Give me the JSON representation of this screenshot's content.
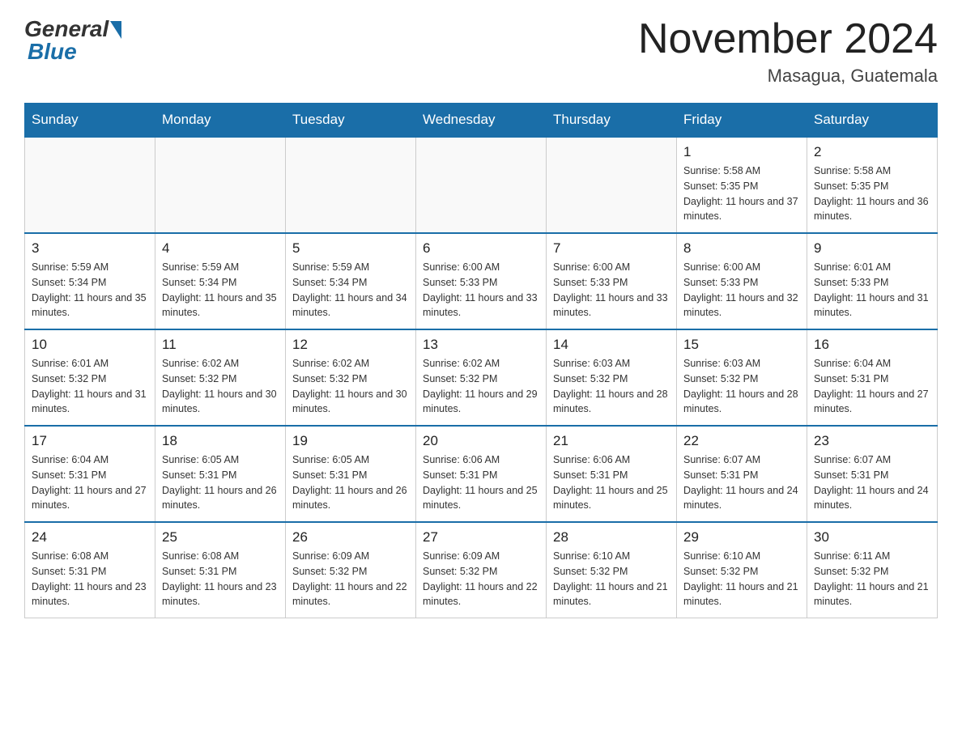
{
  "header": {
    "logo_general": "General",
    "logo_blue": "Blue",
    "month_title": "November 2024",
    "location": "Masagua, Guatemala"
  },
  "days_of_week": [
    "Sunday",
    "Monday",
    "Tuesday",
    "Wednesday",
    "Thursday",
    "Friday",
    "Saturday"
  ],
  "weeks": [
    [
      {
        "day": "",
        "sunrise": "",
        "sunset": "",
        "daylight": ""
      },
      {
        "day": "",
        "sunrise": "",
        "sunset": "",
        "daylight": ""
      },
      {
        "day": "",
        "sunrise": "",
        "sunset": "",
        "daylight": ""
      },
      {
        "day": "",
        "sunrise": "",
        "sunset": "",
        "daylight": ""
      },
      {
        "day": "",
        "sunrise": "",
        "sunset": "",
        "daylight": ""
      },
      {
        "day": "1",
        "sunrise": "Sunrise: 5:58 AM",
        "sunset": "Sunset: 5:35 PM",
        "daylight": "Daylight: 11 hours and 37 minutes."
      },
      {
        "day": "2",
        "sunrise": "Sunrise: 5:58 AM",
        "sunset": "Sunset: 5:35 PM",
        "daylight": "Daylight: 11 hours and 36 minutes."
      }
    ],
    [
      {
        "day": "3",
        "sunrise": "Sunrise: 5:59 AM",
        "sunset": "Sunset: 5:34 PM",
        "daylight": "Daylight: 11 hours and 35 minutes."
      },
      {
        "day": "4",
        "sunrise": "Sunrise: 5:59 AM",
        "sunset": "Sunset: 5:34 PM",
        "daylight": "Daylight: 11 hours and 35 minutes."
      },
      {
        "day": "5",
        "sunrise": "Sunrise: 5:59 AM",
        "sunset": "Sunset: 5:34 PM",
        "daylight": "Daylight: 11 hours and 34 minutes."
      },
      {
        "day": "6",
        "sunrise": "Sunrise: 6:00 AM",
        "sunset": "Sunset: 5:33 PM",
        "daylight": "Daylight: 11 hours and 33 minutes."
      },
      {
        "day": "7",
        "sunrise": "Sunrise: 6:00 AM",
        "sunset": "Sunset: 5:33 PM",
        "daylight": "Daylight: 11 hours and 33 minutes."
      },
      {
        "day": "8",
        "sunrise": "Sunrise: 6:00 AM",
        "sunset": "Sunset: 5:33 PM",
        "daylight": "Daylight: 11 hours and 32 minutes."
      },
      {
        "day": "9",
        "sunrise": "Sunrise: 6:01 AM",
        "sunset": "Sunset: 5:33 PM",
        "daylight": "Daylight: 11 hours and 31 minutes."
      }
    ],
    [
      {
        "day": "10",
        "sunrise": "Sunrise: 6:01 AM",
        "sunset": "Sunset: 5:32 PM",
        "daylight": "Daylight: 11 hours and 31 minutes."
      },
      {
        "day": "11",
        "sunrise": "Sunrise: 6:02 AM",
        "sunset": "Sunset: 5:32 PM",
        "daylight": "Daylight: 11 hours and 30 minutes."
      },
      {
        "day": "12",
        "sunrise": "Sunrise: 6:02 AM",
        "sunset": "Sunset: 5:32 PM",
        "daylight": "Daylight: 11 hours and 30 minutes."
      },
      {
        "day": "13",
        "sunrise": "Sunrise: 6:02 AM",
        "sunset": "Sunset: 5:32 PM",
        "daylight": "Daylight: 11 hours and 29 minutes."
      },
      {
        "day": "14",
        "sunrise": "Sunrise: 6:03 AM",
        "sunset": "Sunset: 5:32 PM",
        "daylight": "Daylight: 11 hours and 28 minutes."
      },
      {
        "day": "15",
        "sunrise": "Sunrise: 6:03 AM",
        "sunset": "Sunset: 5:32 PM",
        "daylight": "Daylight: 11 hours and 28 minutes."
      },
      {
        "day": "16",
        "sunrise": "Sunrise: 6:04 AM",
        "sunset": "Sunset: 5:31 PM",
        "daylight": "Daylight: 11 hours and 27 minutes."
      }
    ],
    [
      {
        "day": "17",
        "sunrise": "Sunrise: 6:04 AM",
        "sunset": "Sunset: 5:31 PM",
        "daylight": "Daylight: 11 hours and 27 minutes."
      },
      {
        "day": "18",
        "sunrise": "Sunrise: 6:05 AM",
        "sunset": "Sunset: 5:31 PM",
        "daylight": "Daylight: 11 hours and 26 minutes."
      },
      {
        "day": "19",
        "sunrise": "Sunrise: 6:05 AM",
        "sunset": "Sunset: 5:31 PM",
        "daylight": "Daylight: 11 hours and 26 minutes."
      },
      {
        "day": "20",
        "sunrise": "Sunrise: 6:06 AM",
        "sunset": "Sunset: 5:31 PM",
        "daylight": "Daylight: 11 hours and 25 minutes."
      },
      {
        "day": "21",
        "sunrise": "Sunrise: 6:06 AM",
        "sunset": "Sunset: 5:31 PM",
        "daylight": "Daylight: 11 hours and 25 minutes."
      },
      {
        "day": "22",
        "sunrise": "Sunrise: 6:07 AM",
        "sunset": "Sunset: 5:31 PM",
        "daylight": "Daylight: 11 hours and 24 minutes."
      },
      {
        "day": "23",
        "sunrise": "Sunrise: 6:07 AM",
        "sunset": "Sunset: 5:31 PM",
        "daylight": "Daylight: 11 hours and 24 minutes."
      }
    ],
    [
      {
        "day": "24",
        "sunrise": "Sunrise: 6:08 AM",
        "sunset": "Sunset: 5:31 PM",
        "daylight": "Daylight: 11 hours and 23 minutes."
      },
      {
        "day": "25",
        "sunrise": "Sunrise: 6:08 AM",
        "sunset": "Sunset: 5:31 PM",
        "daylight": "Daylight: 11 hours and 23 minutes."
      },
      {
        "day": "26",
        "sunrise": "Sunrise: 6:09 AM",
        "sunset": "Sunset: 5:32 PM",
        "daylight": "Daylight: 11 hours and 22 minutes."
      },
      {
        "day": "27",
        "sunrise": "Sunrise: 6:09 AM",
        "sunset": "Sunset: 5:32 PM",
        "daylight": "Daylight: 11 hours and 22 minutes."
      },
      {
        "day": "28",
        "sunrise": "Sunrise: 6:10 AM",
        "sunset": "Sunset: 5:32 PM",
        "daylight": "Daylight: 11 hours and 21 minutes."
      },
      {
        "day": "29",
        "sunrise": "Sunrise: 6:10 AM",
        "sunset": "Sunset: 5:32 PM",
        "daylight": "Daylight: 11 hours and 21 minutes."
      },
      {
        "day": "30",
        "sunrise": "Sunrise: 6:11 AM",
        "sunset": "Sunset: 5:32 PM",
        "daylight": "Daylight: 11 hours and 21 minutes."
      }
    ]
  ]
}
